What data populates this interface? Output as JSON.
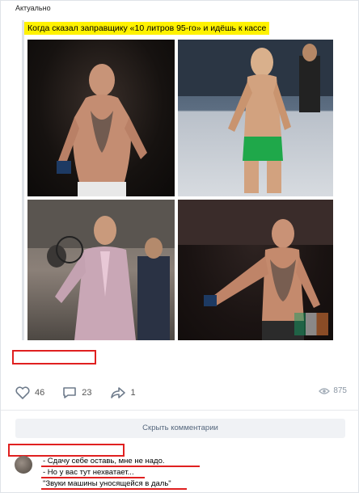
{
  "group": {
    "name": "Актуально"
  },
  "post": {
    "caption": "Когда сказал заправщику «10 литров 95-го» и идёшь к кассе"
  },
  "actions": {
    "likes": "46",
    "comments": "23",
    "shares": "1",
    "views": "875"
  },
  "comments": {
    "hide_label": "Скрыть комментарии",
    "lines": [
      "- Сдачу себе оставь, мне не надо.",
      "- Но у вас тут нехватает...",
      "\"Звуки машины уносящейся в даль\""
    ]
  },
  "colors": {
    "highlight": "#fff200",
    "redact": "#e02020",
    "accent": "#55677d"
  }
}
